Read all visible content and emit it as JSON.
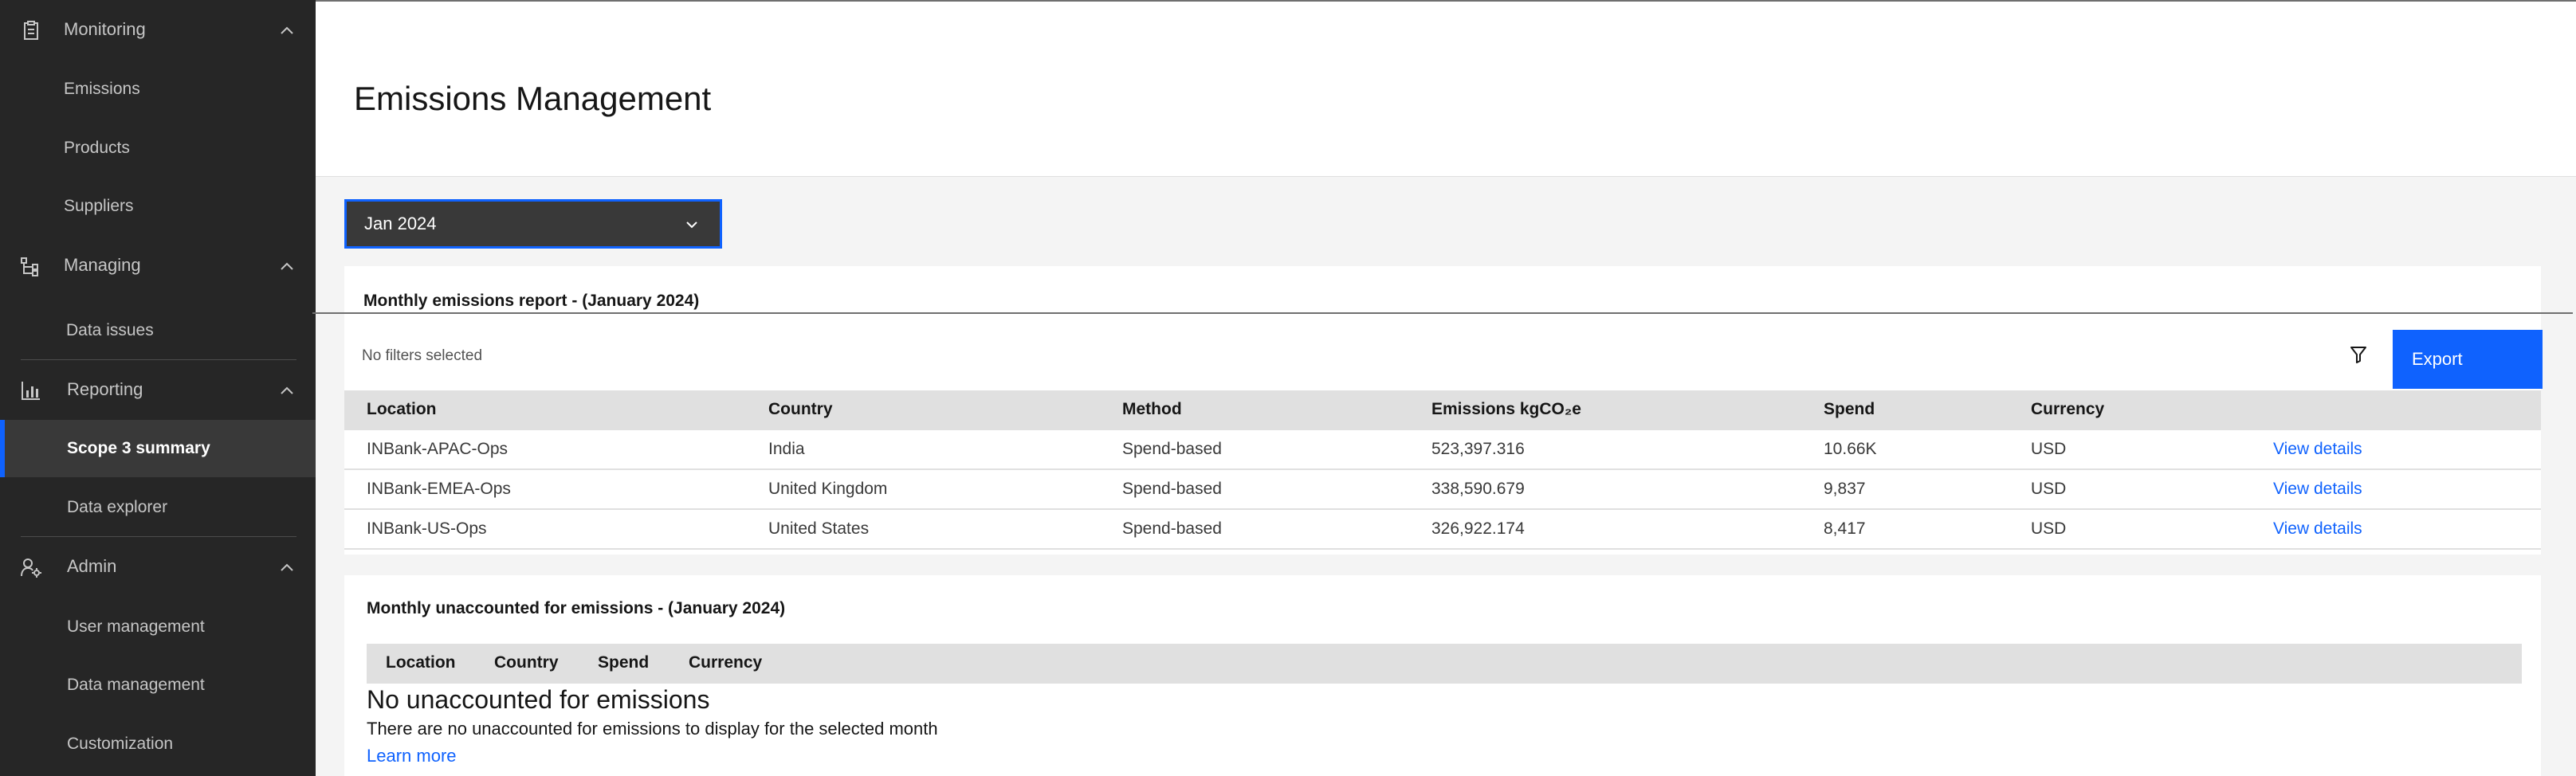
{
  "sidebar": {
    "groups": [
      {
        "label": "Monitoring",
        "icon": "clipboard-icon",
        "items": [
          {
            "label": "Emissions"
          },
          {
            "label": "Products"
          },
          {
            "label": "Suppliers"
          }
        ]
      },
      {
        "label": "Managing",
        "icon": "hierarchy-icon",
        "items": [
          {
            "label": "Data issues"
          }
        ]
      },
      {
        "label": "Reporting",
        "icon": "report-chart-icon",
        "items": [
          {
            "label": "Scope 3 summary"
          },
          {
            "label": "Data explorer"
          }
        ]
      },
      {
        "label": "Admin",
        "icon": "user-admin-icon",
        "items": [
          {
            "label": "User management"
          },
          {
            "label": "Data management"
          },
          {
            "label": "Customization"
          }
        ]
      }
    ],
    "active_item": "Scope 3 summary"
  },
  "header": {
    "title": "Emissions Management"
  },
  "month_select": {
    "value": "Jan 2024"
  },
  "report": {
    "title": "Monthly emissions report - (January 2024)",
    "filters_text": "No filters selected",
    "export_label": "Export",
    "columns": [
      "Location",
      "Country",
      "Method",
      "Emissions kgCO₂e",
      "Spend",
      "Currency"
    ],
    "rows": [
      {
        "location": "INBank-APAC-Ops",
        "country": "India",
        "method": "Spend-based",
        "emissions": "523,397.316",
        "spend": "10.66K",
        "currency": "USD",
        "action": "View details"
      },
      {
        "location": "INBank-EMEA-Ops",
        "country": "United Kingdom",
        "method": "Spend-based",
        "emissions": "338,590.679",
        "spend": "9,837",
        "currency": "USD",
        "action": "View details"
      },
      {
        "location": "INBank-US-Ops",
        "country": "United States",
        "method": "Spend-based",
        "emissions": "326,922.174",
        "spend": "8,417",
        "currency": "USD",
        "action": "View details"
      }
    ]
  },
  "unaccounted": {
    "title": "Monthly unaccounted for emissions - (January 2024)",
    "columns": [
      "Location",
      "Country",
      "Spend",
      "Currency"
    ],
    "empty_title": "No unaccounted for emissions",
    "empty_desc": "There are no unaccounted for emissions to display for the selected month",
    "learn_more": "Learn more"
  },
  "colors": {
    "accent": "#0f62fe",
    "sidebar_bg": "#262626",
    "active_item_bg": "#393939"
  }
}
